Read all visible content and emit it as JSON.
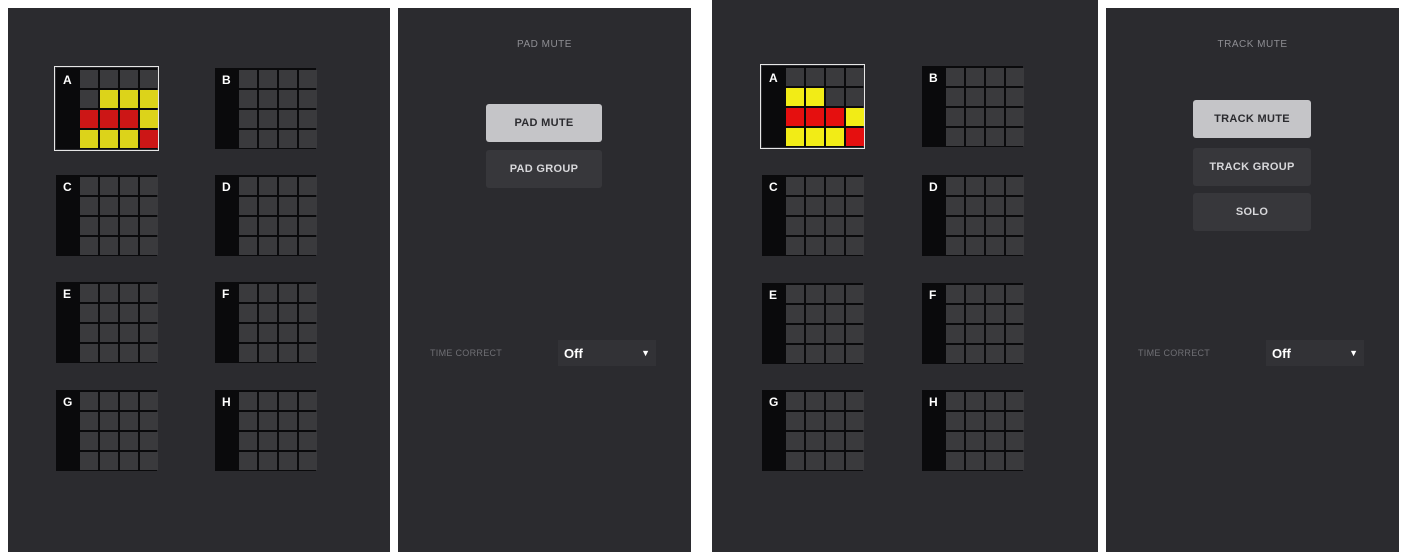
{
  "pad_mute_view": {
    "banks": [
      {
        "letter": "A",
        "selected": true,
        "pads": [
          "off",
          "off",
          "off",
          "off",
          "off",
          "yellow",
          "yellow",
          "yellow",
          "red",
          "red",
          "red",
          "yellow",
          "yellow",
          "yellow",
          "yellow",
          "red"
        ]
      },
      {
        "letter": "B"
      },
      {
        "letter": "C"
      },
      {
        "letter": "D"
      },
      {
        "letter": "E"
      },
      {
        "letter": "F"
      },
      {
        "letter": "G"
      },
      {
        "letter": "H"
      }
    ],
    "panel": {
      "title": "PAD MUTE",
      "buttons": [
        {
          "label": "PAD MUTE",
          "active": true
        },
        {
          "label": "PAD GROUP",
          "active": false
        }
      ],
      "time_correct_label": "TIME CORRECT",
      "time_correct_value": "Off"
    }
  },
  "track_mute_view": {
    "banks": [
      {
        "letter": "A",
        "selected": true,
        "pads": [
          "off",
          "off",
          "off",
          "off",
          "bright-yellow",
          "bright-yellow",
          "off",
          "off",
          "bright-red",
          "bright-red",
          "bright-red",
          "bright-yellow",
          "bright-yellow",
          "bright-yellow",
          "bright-yellow",
          "bright-red"
        ]
      },
      {
        "letter": "B"
      },
      {
        "letter": "C"
      },
      {
        "letter": "D"
      },
      {
        "letter": "E"
      },
      {
        "letter": "F"
      },
      {
        "letter": "G"
      },
      {
        "letter": "H"
      }
    ],
    "panel": {
      "title": "TRACK MUTE",
      "buttons": [
        {
          "label": "TRACK MUTE",
          "active": true
        },
        {
          "label": "TRACK GROUP",
          "active": false
        },
        {
          "label": "SOLO",
          "active": false
        }
      ],
      "time_correct_label": "TIME CORRECT",
      "time_correct_value": "Off"
    }
  },
  "icons": {
    "dropdown_arrow": "▼"
  }
}
